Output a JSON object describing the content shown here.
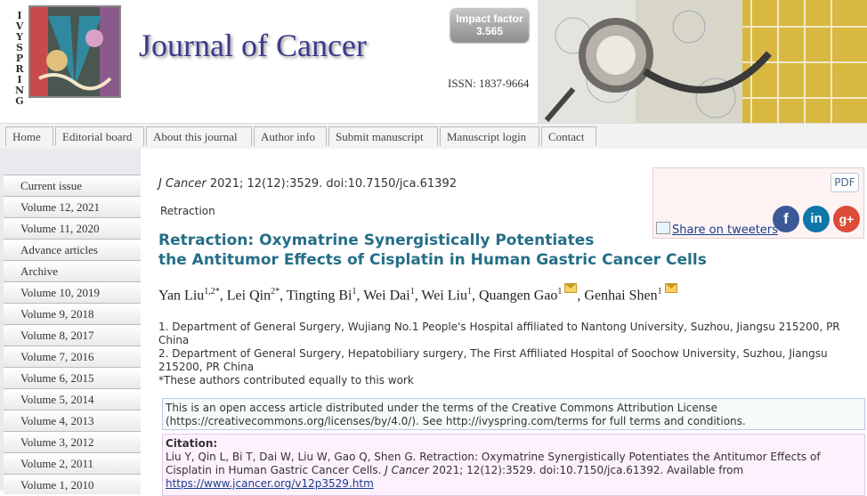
{
  "header": {
    "publisher_vertical": "IVYSPRING",
    "journal_title": "Journal of Cancer",
    "impact_factor_label": "Impact factor",
    "impact_factor_value": "3.565",
    "issn": "ISSN: 1837-9664"
  },
  "nav": {
    "items": [
      "Home",
      "Editorial board",
      "About this journal",
      "Author info",
      "Submit manuscript",
      "Manuscript login",
      "Contact"
    ]
  },
  "sidebar": {
    "items": [
      "Current issue",
      "Volume 12, 2021",
      "Volume 11, 2020",
      "Advance articles",
      "Archive",
      "Volume 10, 2019",
      "Volume 9, 2018",
      "Volume 8, 2017",
      "Volume 7, 2016",
      "Volume 6, 2015",
      "Volume 5, 2014",
      "Volume 4, 2013",
      "Volume 3, 2012",
      "Volume 2, 2011",
      "Volume 1, 2010"
    ]
  },
  "article": {
    "journal_abbrev": "J Cancer",
    "citation_rest": " 2021; 12(12):3529. doi:10.7150/jca.61392",
    "type": "Retraction",
    "title_line1": "Retraction: Oxymatrine Synergistically Potentiates",
    "title_line2": "the Antitumor Effects of Cisplatin in Human Gastric Cancer Cells",
    "authors": [
      {
        "name": "Yan Liu",
        "sup": "1,2*",
        "sep": ", "
      },
      {
        "name": "Lei Qin",
        "sup": "2*",
        "sep": ", "
      },
      {
        "name": "Tingting Bi",
        "sup": "1",
        "sep": ", "
      },
      {
        "name": "Wei Dai",
        "sup": "1",
        "sep": ", "
      },
      {
        "name": "Wei Liu",
        "sup": "1",
        "sep": ", "
      },
      {
        "name": "Quangen Gao",
        "sup": "1",
        "sep": ", "
      },
      {
        "name": "Genhai Shen",
        "sup": "1",
        "sep": ""
      }
    ],
    "affiliation_1": "1. Department of General Surgery, Wujiang No.1 People's Hospital affiliated to Nantong University, Suzhou, Jiangsu 215200, PR China",
    "affiliation_2": "2. Department of General Surgery, Hepatobiliary surgery, The First Affiliated Hospital of Soochow University, Suzhou, Jiangsu 215200, PR China",
    "equal_note": "*These authors contributed equally to this work",
    "license_text": "This is an open access article distributed under the terms of the Creative Commons Attribution License (https://creativecommons.org/licenses/by/4.0/). See http://ivyspring.com/terms for full terms and conditions.",
    "citation_label": "Citation:",
    "citation_text_1": "Liu Y, Qin L, Bi T, Dai W, Liu W, Gao Q, Shen G. Retraction: Oxymatrine Synergistically Potentiates the Antitumor Effects of Cisplatin in Human Gastric Cancer Cells. ",
    "citation_journal": "J Cancer",
    "citation_text_2": " 2021; 12(12):3529. doi:10.7150/jca.61392. Available from",
    "citation_url": "https://www.jcancer.org/v12p3529.htm"
  },
  "share": {
    "pdf_label": "PDF",
    "tweet_label": "Share on tweeters",
    "facebook_glyph": "f",
    "linkedin_glyph": "in",
    "google_glyph": "g+"
  },
  "colors": {
    "title_blue": "#256e88",
    "journal_title_purple": "#3b3a8c",
    "link_blue": "#1a3d8a",
    "facebook": "#3b5998",
    "linkedin": "#0e76a8",
    "google_plus": "#dd4b39"
  }
}
